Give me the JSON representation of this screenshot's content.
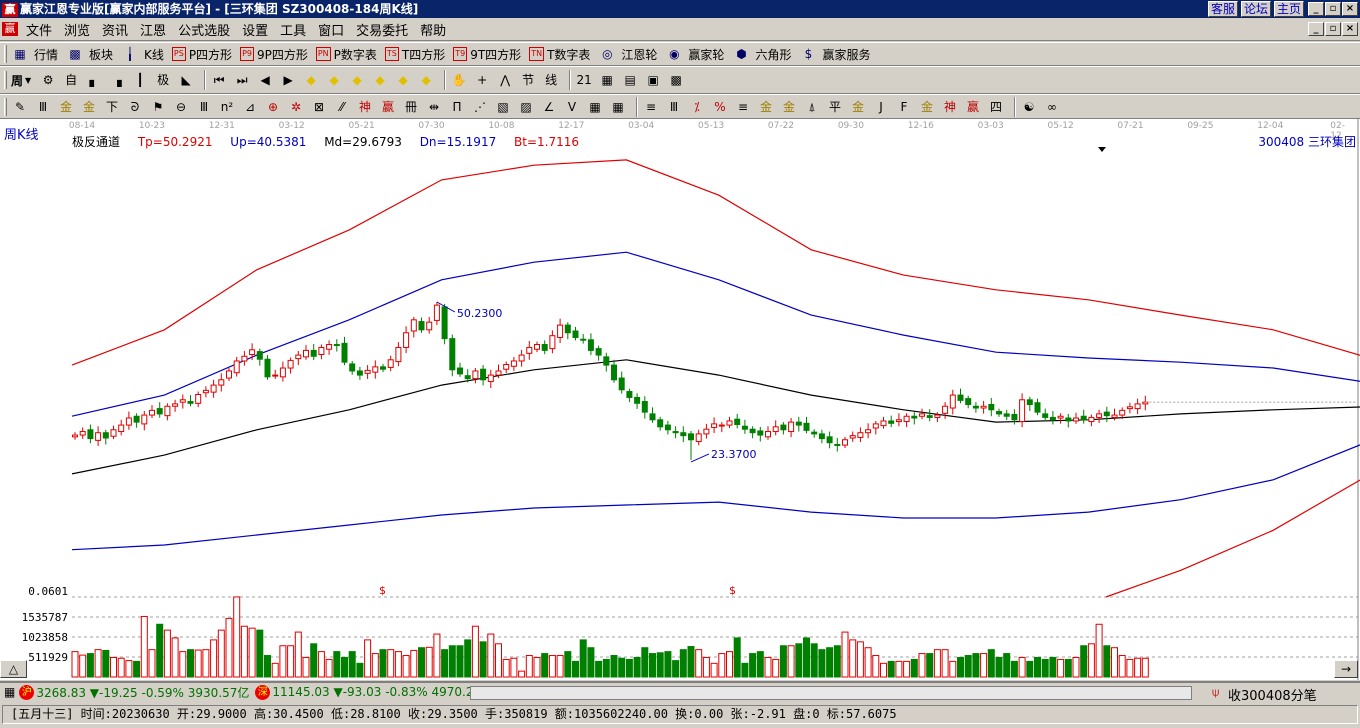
{
  "window": {
    "title": "赢家江恩专业版[赢家内部服务平台] - [三环集团   SZ300408-184周K线]",
    "links": [
      "客服",
      "论坛",
      "主页"
    ],
    "logo": "赢"
  },
  "menu": [
    "文件",
    "浏览",
    "资讯",
    "江恩",
    "公式选股",
    "设置",
    "工具",
    "窗口",
    "交易委托",
    "帮助"
  ],
  "toolbar1": [
    {
      "icon": "grid-icon",
      "glyph": "▦",
      "label": "行情"
    },
    {
      "icon": "blocks-icon",
      "glyph": "▩",
      "label": "板块"
    },
    {
      "icon": "kline-icon",
      "glyph": "╽",
      "label": "K线"
    },
    {
      "icon": "ps-icon",
      "box": "PS",
      "label": "P四方形"
    },
    {
      "icon": "p9-icon",
      "box": "P9",
      "label": "9P四方形"
    },
    {
      "icon": "pn-icon",
      "box": "PN",
      "label": "P数字表"
    },
    {
      "icon": "ts-icon",
      "box": "TS",
      "label": "T四方形"
    },
    {
      "icon": "t9-icon",
      "box": "T9",
      "label": "9T四方形"
    },
    {
      "icon": "tn-icon",
      "box": "TN",
      "label": "T数字表"
    },
    {
      "icon": "gann-wheel-icon",
      "glyph": "◎",
      "label": "江恩轮"
    },
    {
      "icon": "winner-wheel-icon",
      "glyph": "◉",
      "label": "赢家轮"
    },
    {
      "icon": "hexagon-icon",
      "glyph": "⬢",
      "label": "六角形"
    },
    {
      "icon": "dollar-icon",
      "glyph": "$",
      "label": "赢家服务"
    }
  ],
  "toolbar2": {
    "period": "周",
    "icons": [
      "cycle-icon",
      "self-icon",
      "bars3-icon",
      "bars9-icon",
      "candle-icon",
      "extreme-icon",
      "flag-icon",
      "first-icon",
      "last-icon",
      "left-icon",
      "right-icon",
      "diamond-left-icon",
      "diamond-right-icon",
      "diamond-both-icon",
      "diamond-star-icon",
      "diamond-x-icon",
      "diamond-updown-icon",
      "hand-icon",
      "crosshair-icon",
      "wave-icon",
      "node-icon",
      "formula-icon",
      "calendar-icon",
      "calculator-icon",
      "notes-icon",
      "save-icon",
      "network-icon"
    ],
    "glyphs": [
      "⚙",
      "自",
      "▖",
      "▗",
      "┃",
      "极",
      "◣",
      "⏮",
      "⏭",
      "◀",
      "▶",
      "◆",
      "◆",
      "◆",
      "◆",
      "◆",
      "◆",
      "✋",
      "+",
      "⋀",
      "节",
      "线",
      "21",
      "▦",
      "▤",
      "▣",
      "▩"
    ]
  },
  "toolbar3": {
    "icons": [
      "pen-icon",
      "lines-icon",
      "gold1-icon",
      "gold2-icon",
      "f-icon",
      "spiral-icon",
      "fan-icon",
      "circle-icon",
      "parallel-icon",
      "n2-icon",
      "triangle-icon",
      "target-icon",
      "star-icon",
      "square-icon",
      "slant-icon",
      "god-icon",
      "win-icon",
      "box-icon",
      "range-icon",
      "bracket-icon",
      "fan2-icon",
      "square2-icon",
      "box2-icon",
      "angle-icon",
      "v-icon",
      "grid2-icon",
      "grid3-icon",
      "lines3-icon",
      "bars-icon",
      "pct2-icon",
      "pct-icon",
      "pct3-icon",
      "gold-coin-icon",
      "gold3-icon",
      "speed-icon",
      "pf-icon",
      "gold4-icon",
      "j-icon",
      "f2-icon",
      "g-icon",
      "shen-icon",
      "win2-icon",
      "si-icon",
      "yinyang-icon",
      "infinity-icon"
    ],
    "glyphs": [
      "✎",
      "Ⅲ",
      "金",
      "金",
      "下",
      "ᘐ",
      "⚑",
      "⊖",
      "Ⅲ",
      "n²",
      "⊿",
      "⊕",
      "✲",
      "⊠",
      "⁄⁄",
      "神",
      "赢",
      "冊",
      "⇹",
      "П",
      "⋰",
      "▧",
      "▨",
      "∠",
      "V",
      "▦",
      "▦",
      "≡",
      "Ⅲ",
      "⁒",
      "%",
      "≡",
      "金",
      "金",
      "⍋",
      "平",
      "金",
      "J",
      "F",
      "金",
      "神",
      "赢",
      "四",
      "☯",
      "∞"
    ]
  },
  "chart": {
    "period_label": "周K线",
    "dates": [
      "08-14",
      "10-23",
      "12-31",
      "03-12",
      "05-21",
      "07-30",
      "10-08",
      "12-17",
      "03-04",
      "05-13",
      "07-22",
      "09-30",
      "12-16",
      "03-03",
      "05-12",
      "07-21",
      "09-25",
      "12-04",
      "02-12"
    ],
    "indicator": {
      "name": "极反通道",
      "tp": "Tp=50.2921",
      "up": "Up=40.5381",
      "md": "Md=29.6793",
      "dn": "Dn=15.1917",
      "bt": "Bt=1.7116"
    },
    "stock": "300408  三环集团",
    "high_label": "50.2300",
    "low_label": "23.3700",
    "colors": {
      "up": "#e00000",
      "down": "#008000",
      "tp": "#e00000",
      "upband": "#0000c0",
      "md": "#000000",
      "dn": "#0000c0",
      "bt": "#e00000"
    },
    "volume_axis": [
      "0.0601",
      "1535787",
      "1023858",
      "511929"
    ],
    "dollar_marks": [
      "$",
      "$"
    ]
  },
  "chart_data": {
    "type": "candlestick",
    "closes": [
      27.6,
      28.2,
      27.0,
      28.0,
      27.1,
      28.5,
      29.3,
      30.5,
      29.8,
      31.0,
      31.8,
      31.2,
      32.5,
      32.9,
      33.6,
      33.0,
      34.5,
      35.2,
      36.1,
      37.0,
      38.5,
      40.2,
      41.0,
      42.1,
      40.5,
      37.5,
      37.8,
      39.0,
      40.3,
      41.2,
      42.0,
      41.0,
      42.5,
      43.0,
      42.9,
      40.0,
      38.5,
      37.8,
      38.6,
      39.2,
      38.8,
      40.4,
      42.5,
      45.0,
      47.2,
      45.5,
      46.8,
      49.7,
      44.0,
      38.7,
      38.0,
      37.2,
      38.5,
      37.0,
      37.8,
      38.5,
      39.6,
      40.2,
      41.2,
      42.5,
      43.0,
      42.0,
      44.5,
      46.3,
      45.0,
      44.2,
      43.8,
      42.0,
      41.2,
      39.5,
      37.0,
      35.3,
      34.0,
      33.0,
      31.5,
      30.2,
      29.0,
      28.5,
      28.0,
      27.5,
      26.8,
      27.8,
      28.6,
      29.5,
      29.3,
      30.0,
      29.4,
      28.6,
      28.0,
      27.6,
      28.2,
      29.0,
      28.5,
      29.8,
      29.3,
      28.4,
      27.8,
      27.0,
      26.3,
      25.9,
      26.8,
      27.5,
      28.0,
      28.5,
      29.5,
      30.0,
      29.6,
      30.2,
      30.8,
      30.5,
      31.2,
      30.6,
      31.0,
      32.5,
      34.4,
      33.5,
      32.8,
      32.2,
      32.5,
      31.9,
      31.2,
      30.8,
      30.2,
      33.6,
      32.8,
      31.5,
      30.6,
      30.2,
      30.8,
      30.0,
      30.5,
      30.2,
      30.6,
      31.2,
      30.9,
      31.0,
      31.8,
      32.4,
      32.9,
      33.2
    ],
    "volumes": [
      650,
      560,
      600,
      700,
      680,
      500,
      480,
      420,
      400,
      1550,
      700,
      1350,
      1200,
      1000,
      650,
      700,
      690,
      700,
      950,
      1200,
      1500,
      2050,
      1300,
      1250,
      1200,
      550,
      350,
      800,
      800,
      1150,
      500,
      850,
      650,
      450,
      650,
      500,
      650,
      350,
      950,
      600,
      700,
      700,
      650,
      550,
      680,
      750,
      760,
      1100,
      700,
      800,
      800,
      950,
      1300,
      900,
      1100,
      850,
      450,
      480,
      150,
      550,
      500,
      600,
      550,
      550,
      650,
      400,
      950,
      750,
      400,
      450,
      550,
      480,
      450,
      500,
      750,
      600,
      620,
      650,
      420,
      700,
      780,
      700,
      500,
      350,
      600,
      650,
      1000,
      350,
      600,
      650,
      500,
      450,
      800,
      800,
      850,
      1000,
      850,
      700,
      750,
      800,
      1150,
      950,
      900,
      750,
      550,
      350,
      400,
      400,
      400,
      450,
      600,
      600,
      700,
      700,
      400,
      500,
      550,
      600,
      600,
      700,
      500,
      600,
      400,
      500,
      400,
      500,
      450,
      500,
      450,
      450,
      500,
      800,
      850,
      1350,
      800,
      750,
      550,
      450,
      480,
      480,
      450,
      480,
      400,
      450,
      550,
      500,
      60
    ],
    "volume_unit": "thousand shares",
    "high": {
      "index": 47,
      "value": 50.23
    },
    "low": {
      "index": 80,
      "value": 23.37
    },
    "band_step": 12,
    "bands": {
      "tp": [
        39.5,
        45.5,
        55.7,
        62.5,
        71,
        73.5,
        74.4,
        68.4,
        59.1,
        54.8,
        52.3,
        50.6,
        48,
        45.5,
        40.9
      ],
      "up": [
        30.8,
        34.4,
        41.2,
        47.2,
        54,
        57,
        58.7,
        54,
        48,
        44.6,
        41.7,
        40.7,
        40,
        39,
        36.6
      ],
      "md": [
        21,
        24.2,
        28.5,
        31.9,
        36.1,
        38.7,
        40.4,
        37.8,
        34.4,
        31.9,
        29.8,
        30.2,
        31.2,
        31.9,
        32.4
      ],
      "dn": [
        8.1,
        8.9,
        10.6,
        12.3,
        14,
        15.2,
        15.7,
        16.2,
        14.5,
        13.5,
        13.5,
        14.5,
        16.6,
        20,
        26.3
      ],
      "bt": [
        -30,
        -28,
        -26,
        -24,
        -22,
        -20,
        -18,
        -16,
        -14,
        -10,
        -6,
        -1,
        4.6,
        11.4,
        20.5
      ]
    }
  },
  "status": {
    "sh": {
      "badge": "沪",
      "text": "3268.83 ▼-19.25 -0.59% 3930.57亿"
    },
    "sz": {
      "badge": "深",
      "text": "11145.03 ▼-93.03 -0.83% 4970.2"
    },
    "receive": "收300408分笔",
    "detail": "[五月十三] 时间:20230630 开:29.9000 高:30.4500 低:28.8100 收:29.3500 手:350819 额:1035602240.00 换:0.00 张:-2.91 盘:0 标:57.6075"
  },
  "buttons": {
    "triangle": "△",
    "arrow": "→"
  }
}
